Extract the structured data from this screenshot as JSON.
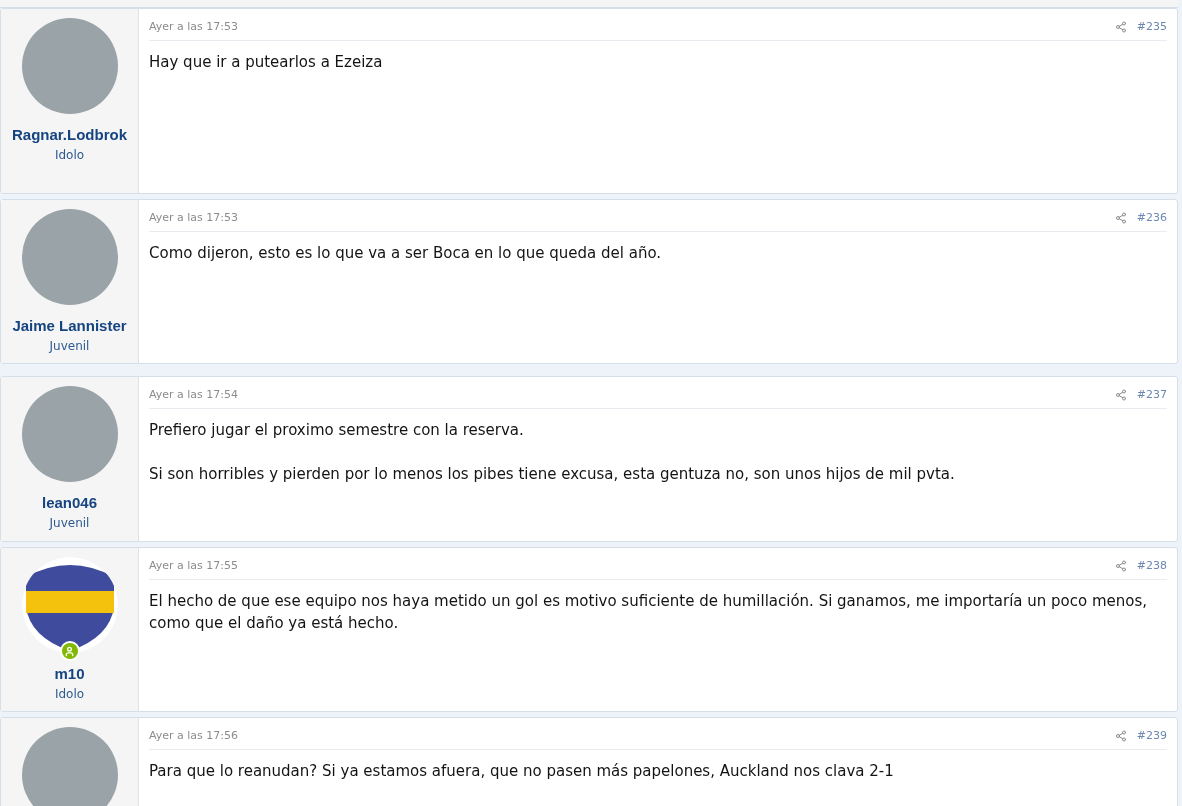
{
  "posts": [
    {
      "username": "Ragnar.Lodbrok",
      "role": "Idolo",
      "online": false,
      "avatar": {
        "kind": "photo"
      },
      "time": "Ayer a las 17:53",
      "number": "#235",
      "paragraphs": [
        "Hay que ir a putearlos a Ezeiza"
      ]
    },
    {
      "username": "Jaime Lannister",
      "role": "Juvenil",
      "online": false,
      "avatar": {
        "kind": "photo"
      },
      "time": "Ayer a las 17:53",
      "number": "#236",
      "paragraphs": [
        "Como dijeron, esto es lo que va a ser Boca en lo que queda del año."
      ]
    },
    {
      "username": "lean046",
      "role": "Juvenil",
      "online": false,
      "avatar": {
        "kind": "photo"
      },
      "time": "Ayer a las 17:54",
      "number": "#237",
      "paragraphs": [
        "Prefiero jugar el proximo semestre con la reserva.",
        "Si son horribles y pierden por lo menos los pibes tiene excusa, esta gentuza no, son unos hijos de mil pvta."
      ]
    },
    {
      "username": "m10",
      "role": "Idolo",
      "online": true,
      "avatar": {
        "kind": "crest"
      },
      "time": "Ayer a las 17:55",
      "number": "#238",
      "paragraphs": [
        "El hecho de que ese equipo nos haya metido un gol es motivo suficiente de humillación. Si ganamos, me importaría un poco menos, como que el daño ya está hecho."
      ]
    },
    {
      "online": false,
      "avatar": {
        "kind": "photo"
      },
      "time": "Ayer a las 17:56",
      "number": "#239",
      "paragraphs": [
        "Para que lo reanudan? Si ya estamos afuera, que no pasen más papelones, Auckland nos clava 2-1"
      ]
    }
  ]
}
